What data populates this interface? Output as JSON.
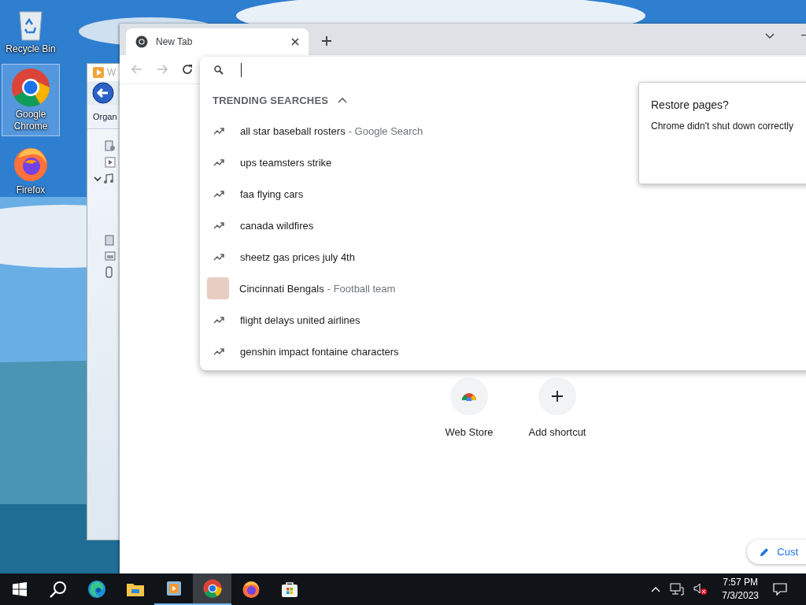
{
  "desktop_icons": [
    {
      "kind": "recycle",
      "label": "Recycle Bin",
      "selected": false
    },
    {
      "kind": "chrome",
      "label": "Google Chrome",
      "selected": true
    },
    {
      "kind": "firefox",
      "label": "Firefox",
      "selected": false
    }
  ],
  "background_window": {
    "title": "W",
    "toolbar_label": "Organ"
  },
  "browser": {
    "tabs": [
      {
        "title": "New Tab",
        "selected": true
      }
    ],
    "suggestions_header": {
      "label": "TRENDING SEARCHES",
      "expanded": true
    },
    "suggestions": [
      {
        "kind": "trend",
        "text": "all star baseball rosters",
        "detail": "- Google Search"
      },
      {
        "kind": "trend",
        "text": "ups teamsters strike"
      },
      {
        "kind": "trend",
        "text": "faa flying cars"
      },
      {
        "kind": "trend",
        "text": "canada wildfires"
      },
      {
        "kind": "trend",
        "text": "sheetz gas prices july 4th"
      },
      {
        "kind": "entity",
        "text": "Cincinnati Bengals",
        "detail": "- Football team"
      },
      {
        "kind": "trend",
        "text": "flight delays united airlines"
      },
      {
        "kind": "trend",
        "text": "genshin impact fontaine characters"
      }
    ],
    "restore_bubble": {
      "title": "Restore pages?",
      "message": "Chrome didn't shut down correctly"
    },
    "shortcuts": [
      {
        "kind": "store",
        "label": "Web Store"
      },
      {
        "kind": "add",
        "label": "Add shortcut"
      }
    ],
    "customize_button": "Cust"
  },
  "taskbar": {
    "apps": [
      {
        "kind": "start",
        "running": false,
        "selected": false
      },
      {
        "kind": "search",
        "running": false,
        "selected": false
      },
      {
        "kind": "edge",
        "running": false,
        "selected": false
      },
      {
        "kind": "explorer",
        "running": false,
        "selected": false
      },
      {
        "kind": "media",
        "running": true,
        "selected": false
      },
      {
        "kind": "chrome",
        "running": true,
        "selected": true
      },
      {
        "kind": "firefox",
        "running": false,
        "selected": false
      },
      {
        "kind": "store",
        "running": false,
        "selected": false
      }
    ],
    "time": "7:57 PM",
    "date": "7/3/2023"
  }
}
